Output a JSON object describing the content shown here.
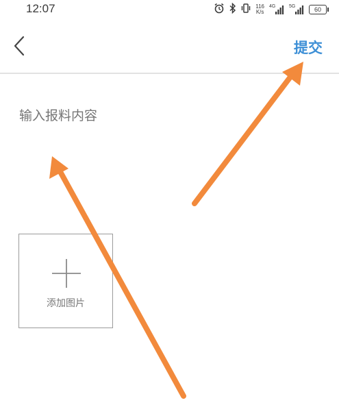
{
  "status_bar": {
    "time": "12:07",
    "net_speed_value": "116",
    "net_speed_unit": "K/s",
    "signal_1_tag": "4G",
    "signal_2_tag": "5G",
    "battery": "60"
  },
  "nav": {
    "submit_label": "提交"
  },
  "form": {
    "content_placeholder": "输入报料内容",
    "add_image_label": "添加图片"
  },
  "colors": {
    "accent": "#3d8fd6",
    "annotation_arrow": "#f28a3c"
  }
}
